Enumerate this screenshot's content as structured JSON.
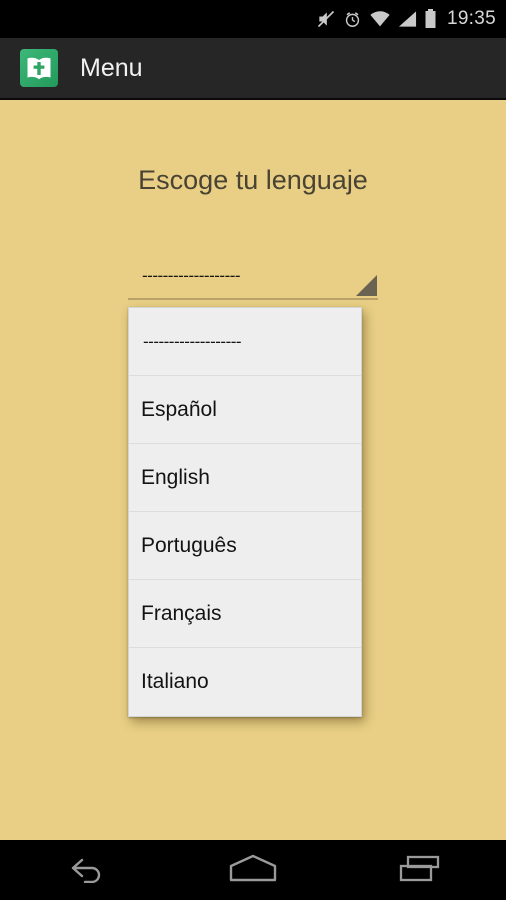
{
  "status_bar": {
    "clock": "19:35",
    "icons": [
      {
        "name": "mute-icon",
        "label": "Silenciar"
      },
      {
        "name": "alarm-icon",
        "label": "Alarma"
      },
      {
        "name": "wifi-icon",
        "label": "Wi-Fi"
      },
      {
        "name": "signal-icon",
        "label": "Señal"
      },
      {
        "name": "battery-icon",
        "label": "Batería"
      }
    ],
    "background_color": "#000000",
    "foreground_color": "#d8d8d8"
  },
  "action_bar": {
    "title": "Menu",
    "app_icon_name": "bible-book-icon",
    "background_color": "#262626",
    "title_color": "#f2f2f2",
    "icon_color": "#2fa563"
  },
  "main": {
    "heading": "Escoge tu lenguaje",
    "background_color": "#e8cf85",
    "heading_color": "#4a4333"
  },
  "spinner": {
    "name": "language-spinner",
    "selected_value": "-------------------",
    "arrow_icon_name": "spinner-triangle-icon",
    "underline_color": "#b9a268",
    "arrow_color": "#6b6351"
  },
  "dropdown": {
    "open": true,
    "background_color": "#eeeeee",
    "divider_color": "#dcdcdc",
    "items": [
      {
        "label": "-------------------",
        "value": "placeholder",
        "selected": true
      },
      {
        "label": "Español",
        "value": "es",
        "selected": false
      },
      {
        "label": "English",
        "value": "en",
        "selected": false
      },
      {
        "label": "Português",
        "value": "pt",
        "selected": false
      },
      {
        "label": "Français",
        "value": "fr",
        "selected": false
      },
      {
        "label": "Italiano",
        "value": "it",
        "selected": false
      }
    ]
  },
  "nav_bar": {
    "background_color": "#000000",
    "buttons": [
      {
        "name": "nav-back-button",
        "label": "Atrás"
      },
      {
        "name": "nav-home-button",
        "label": "Inicio"
      },
      {
        "name": "nav-recents-button",
        "label": "Recientes"
      }
    ]
  }
}
